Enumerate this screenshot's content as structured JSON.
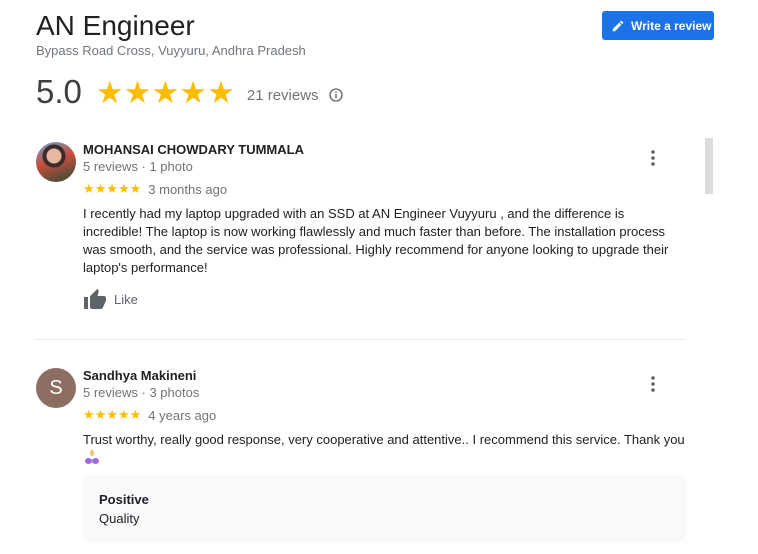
{
  "header": {
    "title": "AN Engineer",
    "address": "Bypass Road Cross, Vuyyuru, Andhra Pradesh",
    "write_review_label": "Write a review",
    "rating": "5.0",
    "stars": "★★★★★",
    "review_count": "21 reviews"
  },
  "colors": {
    "accent": "#1a73e8",
    "star": "#fbbc04",
    "secondary_text": "#70757a"
  },
  "reviews": [
    {
      "name": "MOHANSAI CHOWDARY TUMMALA",
      "meta": "5 reviews · 1 photo",
      "stars": "★★★★★",
      "rating": 5,
      "date": "3 months ago",
      "text": "I recently had my laptop upgraded with an SSD at AN Engineer Vuyyuru , and the difference is incredible! The laptop is now working flawlessly and much faster than before. The installation process was smooth, and the service was professional. Highly recommend for anyone looking to upgrade their laptop's performance!",
      "like_label": "Like",
      "avatar_icon": "profile-photo"
    },
    {
      "name": "Sandhya Makineni",
      "avatar_letter": "S",
      "meta": "5 reviews · 3 photos",
      "stars": "★★★★★",
      "rating": 5,
      "date": "4 years ago",
      "text": "Trust worthy, really good response, very cooperative and attentive.. I recommend this service. Thank you",
      "attribute_title": "Positive",
      "attribute_value": "Quality"
    }
  ]
}
